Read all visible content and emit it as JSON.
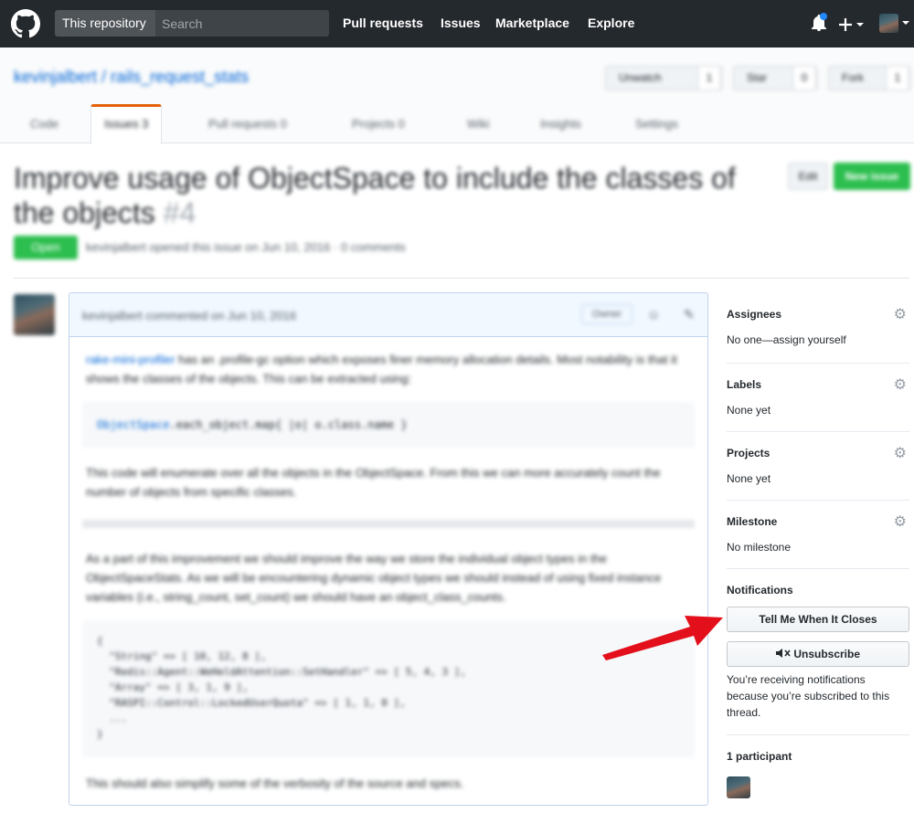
{
  "header": {
    "scope_label": "This repository",
    "search_placeholder": "Search",
    "nav": [
      "Pull requests",
      "Issues",
      "Marketplace",
      "Explore"
    ]
  },
  "repo": {
    "title": "kevinjalbert / rails_request_stats",
    "watch_label": "Unwatch",
    "watch_count": "1",
    "star_label": "Star",
    "star_count": "0",
    "fork_label": "Fork",
    "fork_count": "1",
    "tabs": [
      "Code",
      "Issues 3",
      "Pull requests 0",
      "Projects 0",
      "Wiki",
      "Insights",
      "Settings"
    ]
  },
  "issue": {
    "title": "Improve usage of ObjectSpace to include the classes of the objects",
    "number": "#4",
    "state": "Open",
    "meta": "kevinjalbert opened this issue on Jun 10, 2016 · 0 comments",
    "edit_label": "Edit",
    "new_issue_label": "New issue"
  },
  "comment": {
    "header": "kevinjalbert commented on Jun 10, 2016",
    "badge": "Owner",
    "p1_link": "rake-mini-profiler",
    "p1_text": " has an .profile-gc option which exposes finer memory allocation details. Most notability is that it shows the classes of the objects. This can be extracted using:",
    "code_obj": "ObjectSpace",
    "code_rest": ".each_object.map{ |o| o.class.name }",
    "p2": "This code will enumerate over all the objects in the ObjectSpace. From this we can more accurately count the number of objects from specific classes.",
    "p3": "As a part of this improvement we should improve the way we store the individual object types in the ObjectSpaceStats. As we will be encountering dynamic object types we should instead of using fixed instance variables (i.e., string_count, set_count) we should have an object_class_counts.",
    "code_block": "{\n  \"String\" => [ 10, 12, 8 ],\n  \"Redis::Agent::WeHeldAttention::SetHandler\" => [ 5, 4, 3 ],\n  \"Array\" => [ 3, 1, 9 ],\n  \"RASPI::Control::LockedUserQuota\" => [ 1, 1, 0 ],\n  ...\n}",
    "p4": "This should also simplify some of the verbosity of the source and specs."
  },
  "sidebar": {
    "assignees_heading": "Assignees",
    "assignees_value": "No one—assign yourself",
    "labels_heading": "Labels",
    "labels_value": "None yet",
    "projects_heading": "Projects",
    "projects_value": "None yet",
    "milestone_heading": "Milestone",
    "milestone_value": "No milestone",
    "notifications_heading": "Notifications",
    "tell_me_label": "Tell Me When It Closes",
    "unsubscribe_label": "Unsubscribe",
    "notif_text": "You’re receiving notifications because you’re subscribed to this thread.",
    "participants_heading": "1 participant"
  },
  "colors": {
    "header_bg": "#24292e",
    "open_green": "#2cbe4e",
    "link_blue": "#0366d6",
    "arrow_red": "#e3101b"
  },
  "icons": [
    "github-logo-icon",
    "bell-icon",
    "plus-icon",
    "user-avatar-icon",
    "gear-icon",
    "mute-icon",
    "arrow-annotation-icon"
  ]
}
